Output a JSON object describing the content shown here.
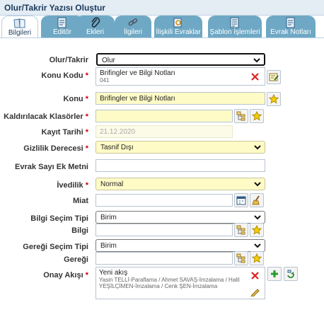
{
  "window": {
    "title": "Olur/Takrir Yazısı Oluştur"
  },
  "tabs": [
    {
      "label": "Bilgileri",
      "icon": "book-icon",
      "active": true
    },
    {
      "label": "Editör",
      "icon": "document-edit-icon"
    },
    {
      "label": "Ekleri",
      "icon": "paperclip-icon"
    },
    {
      "label": "İlgileri",
      "icon": "link-icon"
    },
    {
      "label": "İlişkili Evraklar",
      "icon": "related-docs-icon"
    },
    {
      "label": "Şablon İşlemleri",
      "icon": "template-icon"
    },
    {
      "label": "Evrak Notları",
      "icon": "notes-icon"
    }
  ],
  "form": {
    "olur_takrir": {
      "label": "Olur/Takrir",
      "value": "Olur"
    },
    "konu_kodu": {
      "label": "Konu Kodu",
      "value": "Brifingler ve Bilgi Notları",
      "code": "041"
    },
    "konu": {
      "label": "Konu",
      "value": "Brifingler ve Bilgi Notları"
    },
    "klasorler": {
      "label": "Kaldırılacak Klasörler",
      "value": ""
    },
    "kayit_tarihi": {
      "label": "Kayıt Tarihi",
      "value": "21.12.2020"
    },
    "gizlilik": {
      "label": "Gizlilik Derecesi",
      "value": "Tasnif Dışı"
    },
    "ek_metni": {
      "label": "Evrak Sayı Ek Metni",
      "value": ""
    },
    "ivedilik": {
      "label": "İvedilik",
      "value": "Normal"
    },
    "miat": {
      "label": "Miat",
      "value": ""
    },
    "bilgi_secim": {
      "label": "Bilgi Seçim Tipi",
      "value": "Birim"
    },
    "bilgi": {
      "label": "Bilgi",
      "value": ""
    },
    "geregi_secim": {
      "label": "Gereği Seçim Tipi",
      "value": "Birim"
    },
    "geregi": {
      "label": "Gereği",
      "value": ""
    },
    "onay_akisi": {
      "label": "Onay Akışı",
      "title": "Yeni akış",
      "line1": "Yasin TELLİ-Paraflama / Ahmet SAVAŞ-İmzalama / Halil",
      "line2": "YEŞİLÇİMEN-İmzalama / Cenk ŞEN-İmzalama"
    },
    "required_mark": "*"
  }
}
